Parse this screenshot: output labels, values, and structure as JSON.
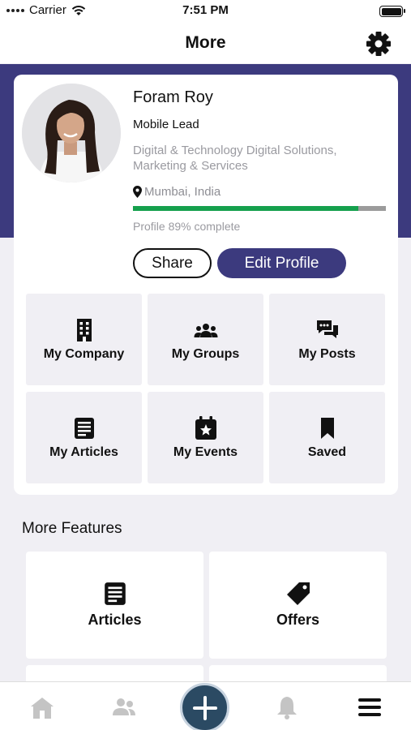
{
  "status_bar": {
    "carrier": "Carrier",
    "time": "7:51 PM"
  },
  "nav": {
    "title": "More",
    "settings_icon": "gear-icon"
  },
  "profile": {
    "name": "Foram Roy",
    "role": "Mobile Lead",
    "department": "Digital & Technology Digital Solutions, Marketing & Services",
    "location": "Mumbai, India",
    "completion_percent": 89,
    "completion_text": "Profile 89% complete",
    "share_label": "Share",
    "edit_label": "Edit Profile"
  },
  "tiles": [
    {
      "label": "My Company",
      "icon": "building-icon"
    },
    {
      "label": "My Groups",
      "icon": "people-group-icon"
    },
    {
      "label": "My Posts",
      "icon": "chat-bubbles-icon"
    },
    {
      "label": "My Articles",
      "icon": "article-icon"
    },
    {
      "label": "My Events",
      "icon": "calendar-star-icon"
    },
    {
      "label": "Saved",
      "icon": "bookmark-icon"
    }
  ],
  "more_features": {
    "title": "More Features",
    "items": [
      {
        "label": "Articles",
        "icon": "article-icon"
      },
      {
        "label": "Offers",
        "icon": "tag-icon"
      }
    ]
  },
  "tab_bar": {
    "items": [
      "home-icon",
      "people-icon",
      "add-icon",
      "bell-icon",
      "menu-icon"
    ],
    "active": "menu-icon"
  },
  "colors": {
    "brand": "#3c3a7e",
    "progress": "#15a04d",
    "tile_bg": "#f0eff4",
    "fab": "#2b4a63"
  }
}
